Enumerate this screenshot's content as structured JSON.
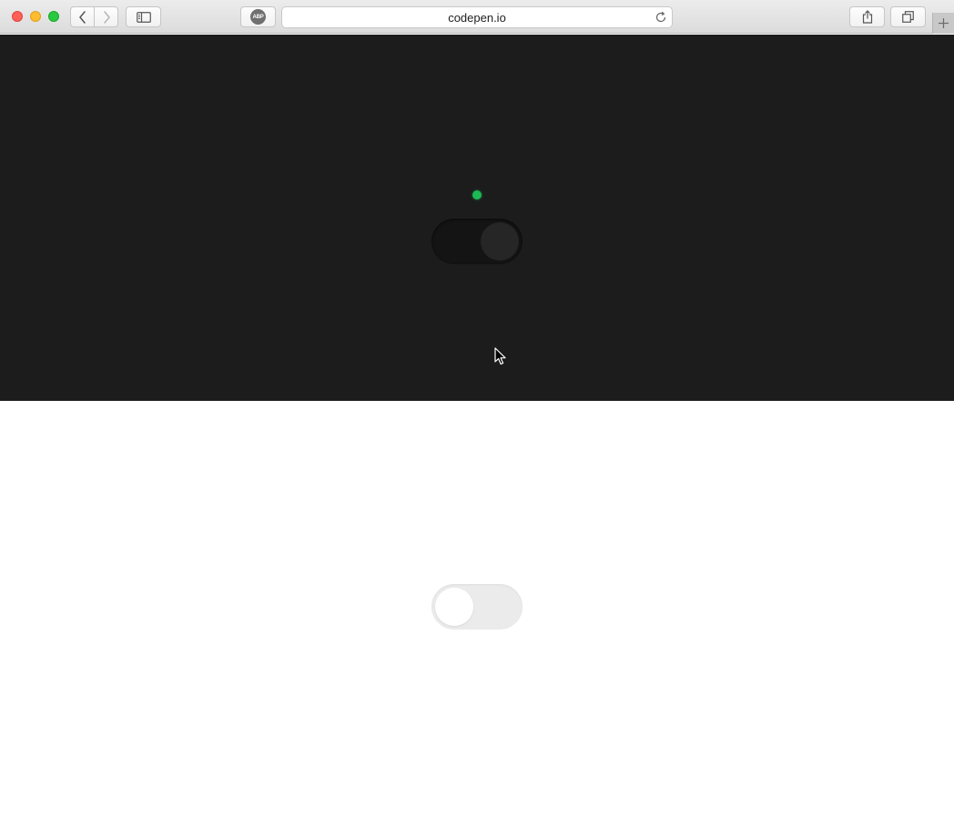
{
  "browser": {
    "address": "codepen.io",
    "abp_label": "ABP",
    "icons": {
      "back": "chevron-left-icon",
      "forward": "chevron-right-icon",
      "sidebar": "sidebar-icon",
      "reload": "reload-icon",
      "share": "share-icon",
      "tabs": "tabs-icon",
      "new_tab": "plus-icon"
    }
  },
  "demo": {
    "dark_toggle": {
      "state": "on",
      "background": "#1c1c1c",
      "indicator_color": "#1db954"
    },
    "light_toggle": {
      "state": "off",
      "background": "#ffffff"
    }
  }
}
